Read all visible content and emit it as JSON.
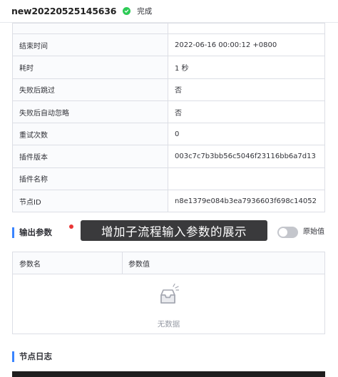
{
  "header": {
    "task_name": "new20220525145636",
    "status": "完成",
    "status_color": "#2dcb56"
  },
  "info_rows": [
    {
      "key": "结束时间",
      "value": "2022-06-16 00:00:12 +0800"
    },
    {
      "key": "耗时",
      "value": "1 秒"
    },
    {
      "key": "失败后跳过",
      "value": "否"
    },
    {
      "key": "失败后自动忽略",
      "value": "否"
    },
    {
      "key": "重试次数",
      "value": "0"
    },
    {
      "key": "插件版本",
      "value": "003c7c7b3bb56c5046f23116bb6a7d13"
    },
    {
      "key": "插件名称",
      "value": ""
    },
    {
      "key": "节点ID",
      "value": "n8e1379e084b3ea7936603f698c14052"
    }
  ],
  "output_section": {
    "title": "输出参数",
    "annotation": "增加子流程输入参数的展示",
    "toggle_label": "原始值",
    "toggle_on": false,
    "columns": [
      "参数名",
      "参数值"
    ],
    "empty_text": "无数据"
  },
  "log_section": {
    "title": "节点日志"
  },
  "colors": {
    "accent": "#3a84ff",
    "marker": "#ea3636",
    "tooltip_bg": "#3a3a3c"
  }
}
